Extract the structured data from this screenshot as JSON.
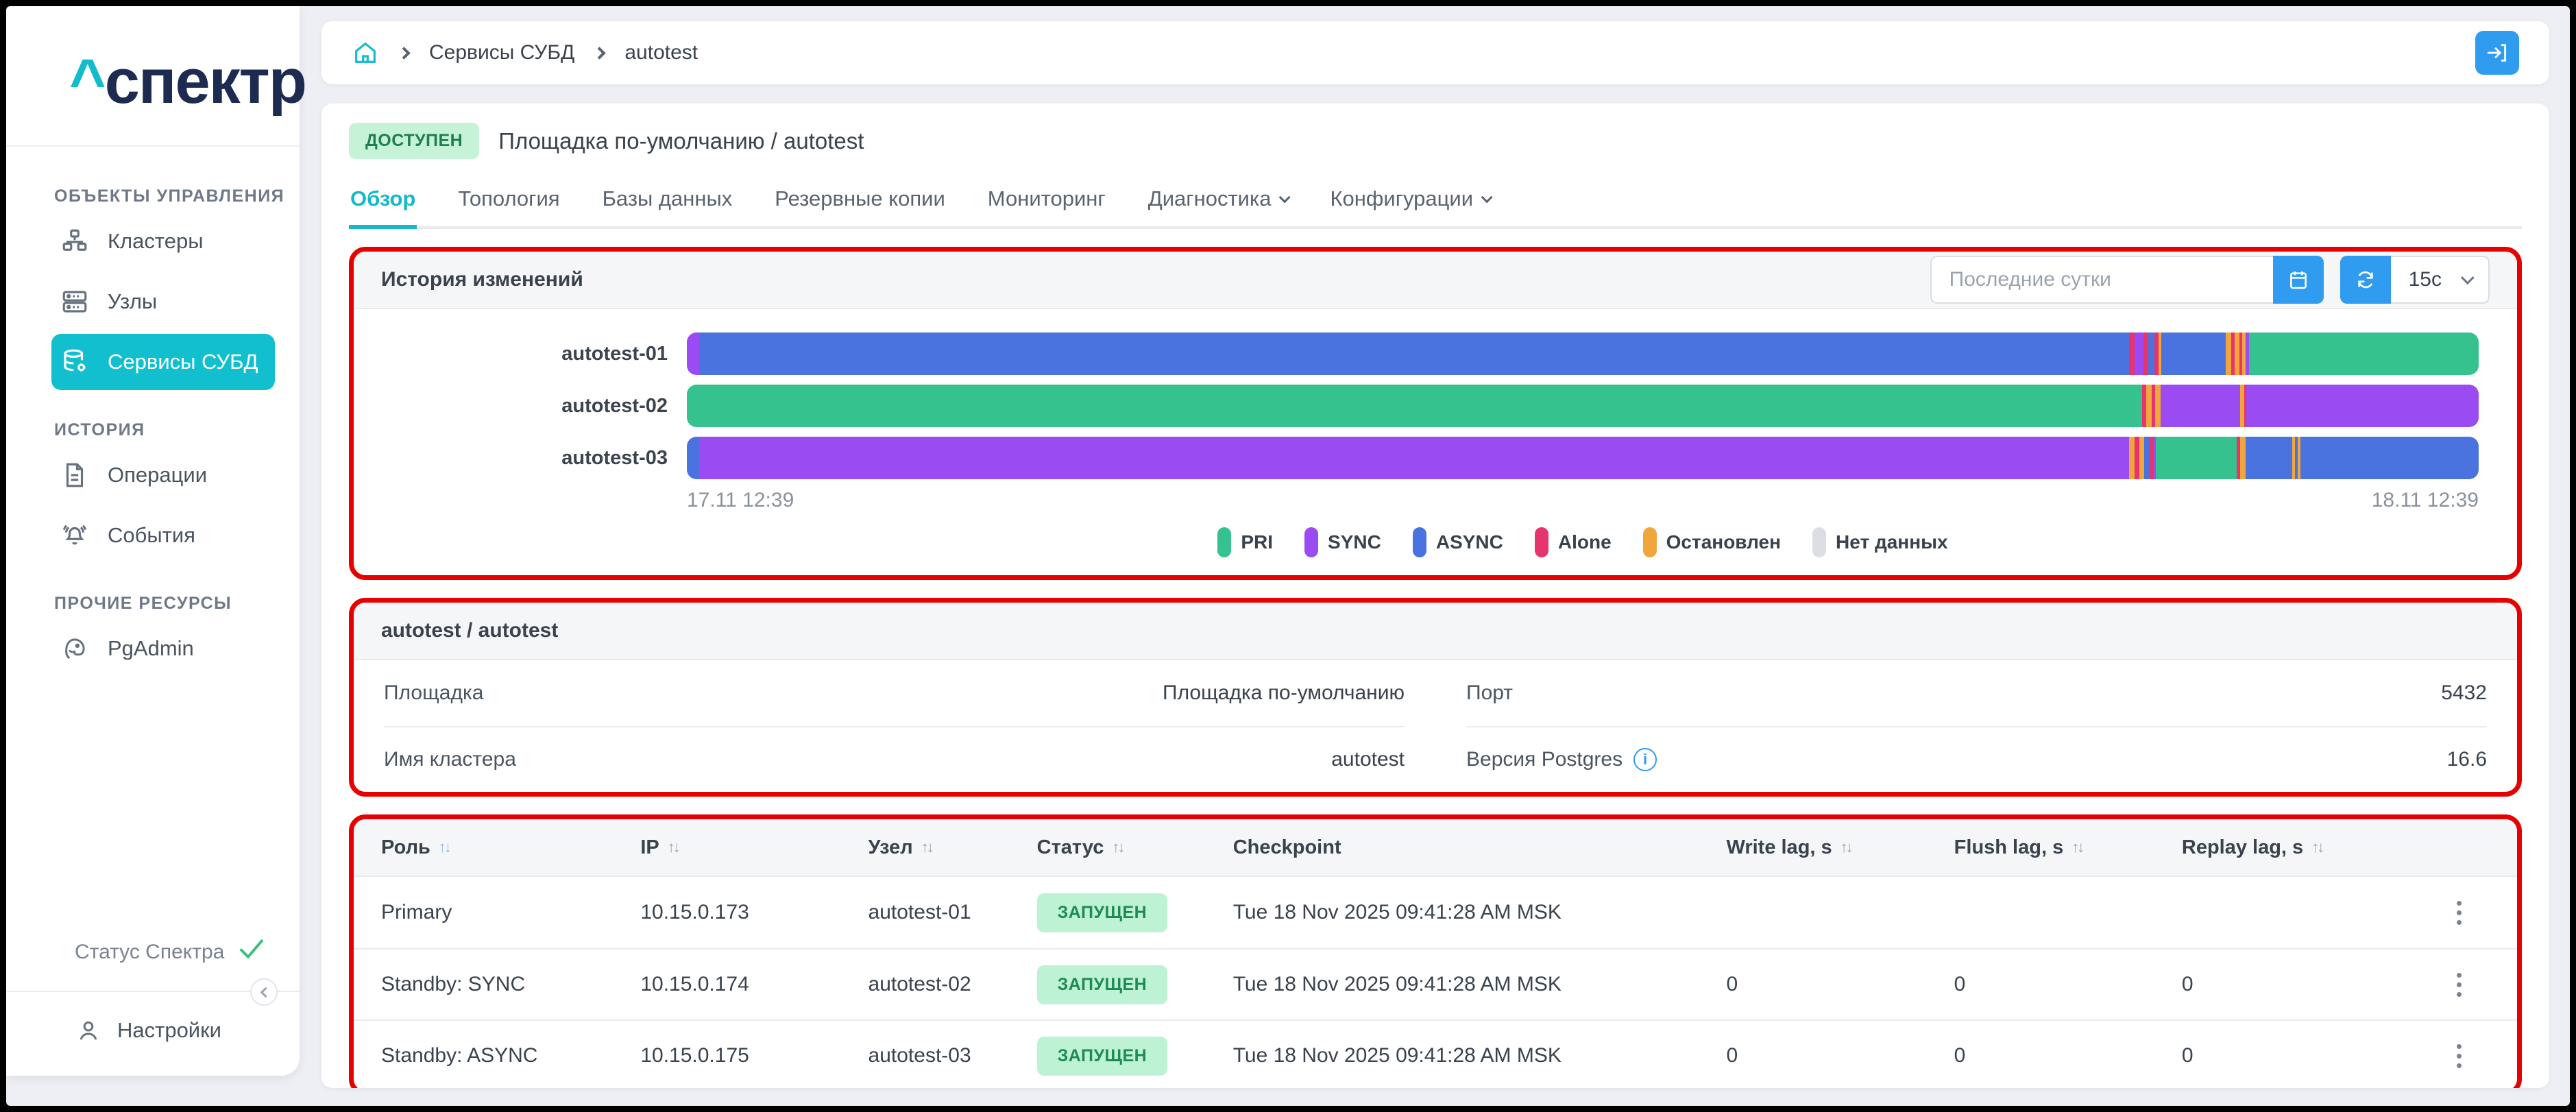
{
  "sidebar": {
    "logo_caret": "^",
    "logo_text": "спектр",
    "sections": [
      {
        "label": "ОБЪЕКТЫ УПРАВЛЕНИЯ",
        "items": [
          {
            "label": "Кластеры",
            "icon": "clusters-icon"
          },
          {
            "label": "Узлы",
            "icon": "nodes-icon"
          },
          {
            "label": "Сервисы СУБД",
            "icon": "database-gear-icon"
          }
        ]
      },
      {
        "label": "ИСТОРИЯ",
        "items": [
          {
            "label": "Операции",
            "icon": "document-icon"
          },
          {
            "label": "События",
            "icon": "bell-icon"
          }
        ]
      },
      {
        "label": "ПРОЧИЕ РЕСУРСЫ",
        "items": [
          {
            "label": "PgAdmin",
            "icon": "pgadmin-elephant-icon"
          }
        ]
      }
    ],
    "footer": {
      "status_label": "Статус Спектра",
      "settings_label": "Настройки"
    }
  },
  "breadcrumb": {
    "items": [
      "Сервисы СУБД",
      "autotest"
    ]
  },
  "header": {
    "status_badge": "ДОСТУПЕН",
    "title": "Площадка по-умолчанию /  autotest"
  },
  "tabs": {
    "items": [
      {
        "label": "Обзор"
      },
      {
        "label": "Топология"
      },
      {
        "label": "Базы данных"
      },
      {
        "label": "Резервные копии"
      },
      {
        "label": "Мониторинг"
      },
      {
        "label": "Диагностика",
        "dropdown": true
      },
      {
        "label": "Конфигурации",
        "dropdown": true
      }
    ],
    "active": "Обзор"
  },
  "history_panel": {
    "title": "История изменений",
    "range_value": "Последние сутки",
    "refresh_interval": "15с"
  },
  "chart_data": {
    "type": "timeline-status-bars",
    "x_start_label": "17.11 12:39",
    "x_end_label": "18.11 12:39",
    "colors": {
      "pri": "#35C28E",
      "sync": "#9B4BF2",
      "async": "#4A73DF",
      "alone": "#E5346E",
      "stopped": "#F0A63A",
      "nodata": "#DCDEE4"
    },
    "legend": [
      {
        "label": "PRI",
        "status": "pri"
      },
      {
        "label": "SYNC",
        "status": "sync"
      },
      {
        "label": "ASYNC",
        "status": "async"
      },
      {
        "label": "Alone",
        "status": "alone"
      },
      {
        "label": "Остановлен",
        "status": "stopped"
      },
      {
        "label": "Нет данных",
        "status": "nodata"
      }
    ],
    "rows": [
      {
        "label": "autotest-01",
        "segments": [
          [
            "sync",
            0.7
          ],
          [
            "async",
            79.8
          ],
          [
            "alone",
            0.3
          ],
          [
            "sync",
            0.5
          ],
          [
            "alone",
            0.25
          ],
          [
            "async",
            0.35
          ],
          [
            "alone",
            0.25
          ],
          [
            "stopped",
            0.15
          ],
          [
            "async",
            3.6
          ],
          [
            "stopped",
            0.3
          ],
          [
            "alone",
            0.2
          ],
          [
            "stopped",
            0.25
          ],
          [
            "alone",
            0.15
          ],
          [
            "stopped",
            0.2
          ],
          [
            "sync",
            0.2
          ],
          [
            "pri",
            12.8
          ]
        ]
      },
      {
        "label": "autotest-02",
        "segments": [
          [
            "pri",
            81.2
          ],
          [
            "alone",
            0.25
          ],
          [
            "stopped",
            0.3
          ],
          [
            "alone",
            0.2
          ],
          [
            "stopped",
            0.3
          ],
          [
            "sync",
            4.45
          ],
          [
            "stopped",
            0.2
          ],
          [
            "alone",
            0.15
          ],
          [
            "sync",
            12.95
          ]
        ]
      },
      {
        "label": "autotest-03",
        "segments": [
          [
            "async",
            0.7
          ],
          [
            "sync",
            79.8
          ],
          [
            "stopped",
            0.3
          ],
          [
            "alone",
            0.25
          ],
          [
            "stopped",
            0.3
          ],
          [
            "async",
            0.3
          ],
          [
            "alone",
            0.2
          ],
          [
            "sync",
            0.15
          ],
          [
            "pri",
            4.5
          ],
          [
            "alone",
            0.2
          ],
          [
            "stopped",
            0.3
          ],
          [
            "async",
            2.6
          ],
          [
            "stopped",
            0.15
          ],
          [
            "async",
            0.15
          ],
          [
            "stopped",
            0.15
          ],
          [
            "async",
            9.95
          ]
        ]
      }
    ]
  },
  "info_panel": {
    "title": "autotest / autotest",
    "left_rows": [
      {
        "label": "Площадка",
        "value": "Площадка по-умолчанию"
      },
      {
        "label": "Имя кластера",
        "value": "autotest"
      }
    ],
    "right_rows": [
      {
        "label": "Порт",
        "value": "5432"
      },
      {
        "label": "Версия Postgres",
        "value": "16.6"
      }
    ]
  },
  "table": {
    "columns": [
      {
        "label": "Роль"
      },
      {
        "label": "IP"
      },
      {
        "label": "Узел"
      },
      {
        "label": "Статус"
      },
      {
        "label": "Checkpoint"
      },
      {
        "label": "Write lag, s"
      },
      {
        "label": "Flush lag, s"
      },
      {
        "label": "Replay lag, s"
      }
    ],
    "rows": [
      {
        "role": "Primary",
        "ip": "10.15.0.173",
        "node": "autotest-01",
        "status": "ЗАПУЩЕН",
        "checkpoint": "Tue 18 Nov 2025 09:41:28 AM MSK",
        "write_lag": "",
        "flush_lag": "",
        "replay_lag": ""
      },
      {
        "role": "Standby: SYNC",
        "ip": "10.15.0.174",
        "node": "autotest-02",
        "status": "ЗАПУЩЕН",
        "checkpoint": "Tue 18 Nov 2025 09:41:28 AM MSK",
        "write_lag": "0",
        "flush_lag": "0",
        "replay_lag": "0"
      },
      {
        "role": "Standby: ASYNC",
        "ip": "10.15.0.175",
        "node": "autotest-03",
        "status": "ЗАПУЩЕН",
        "checkpoint": "Tue 18 Nov 2025 09:41:28 AM MSK",
        "write_lag": "0",
        "flush_lag": "0",
        "replay_lag": "0"
      }
    ]
  },
  "annotation_color": "#E60000"
}
